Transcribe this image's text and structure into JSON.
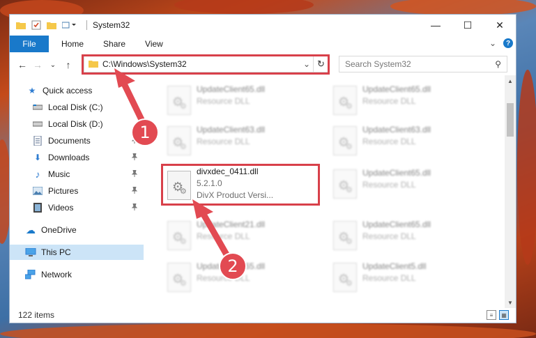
{
  "window": {
    "title": "System32",
    "controls": {
      "minimize": "—",
      "maximize": "☐",
      "close": "✕"
    }
  },
  "ribbon": {
    "tabs": [
      "File",
      "Home",
      "Share",
      "View"
    ],
    "expand_glyph": "⌄",
    "help": "?"
  },
  "nav": {
    "back": "←",
    "forward": "→",
    "recent": "⌄",
    "up": "↑",
    "address": "C:\\Windows\\System32",
    "address_dropdown": "⌄",
    "refresh": "↻",
    "search_placeholder": "Search System32",
    "search_glyph": "⚲"
  },
  "sidebar": {
    "items": [
      {
        "label": "Quick access",
        "icon": "star-icon",
        "glyph": "★",
        "color": "#2f7dd1"
      },
      {
        "label": "Local Disk (C:)",
        "icon": "drive-icon",
        "glyph": "▭",
        "color": "#555555"
      },
      {
        "label": "Local Disk (D:)",
        "icon": "drive-icon",
        "glyph": "▭",
        "color": "#555555"
      },
      {
        "label": "Documents",
        "icon": "documents-icon",
        "glyph": "▤",
        "color": "#5a6e8c",
        "pin": "📌"
      },
      {
        "label": "Downloads",
        "icon": "download-icon",
        "glyph": "⬇",
        "color": "#2f7dd1",
        "pin": "📌"
      },
      {
        "label": "Music",
        "icon": "music-icon",
        "glyph": "♪",
        "color": "#2f7dd1",
        "pin": "📌"
      },
      {
        "label": "Pictures",
        "icon": "pictures-icon",
        "glyph": "▨",
        "color": "#4a7fb0",
        "pin": "📌"
      },
      {
        "label": "Videos",
        "icon": "videos-icon",
        "glyph": "▦",
        "color": "#555555",
        "pin": "📌"
      },
      {
        "label": "OneDrive",
        "icon": "cloud-icon",
        "glyph": "☁",
        "color": "#1979ca"
      },
      {
        "label": "This PC",
        "icon": "computer-icon",
        "glyph": "▭",
        "color": "#2f7dd1"
      },
      {
        "label": "Network",
        "icon": "network-icon",
        "glyph": "⧉",
        "color": "#2f7dd1"
      }
    ]
  },
  "files": [
    {
      "name": "UpdateClient65.dll",
      "sub1": "Resource DLL",
      "sub2": ""
    },
    {
      "name": "UpdateClient65.dll",
      "sub1": "Resource DLL",
      "sub2": ""
    },
    {
      "name": "UpdateClient63.dll",
      "sub1": "Resource DLL",
      "sub2": ""
    },
    {
      "name": "UpdateClient63.dll",
      "sub1": "Resource DLL",
      "sub2": ""
    },
    {
      "name": "divxdec_0411.dll",
      "sub1": "5.2.1.0",
      "sub2": "DivX  Product Versi..."
    },
    {
      "name": "UpdateClient65.dll",
      "sub1": "Resource DLL",
      "sub2": ""
    },
    {
      "name": "UpdateClient21.dll",
      "sub1": "Resource DLL",
      "sub2": ""
    },
    {
      "name": "UpdateClient65.dll",
      "sub1": "Resource DLL",
      "sub2": ""
    },
    {
      "name": "UpdateClient65.dll",
      "sub1": "Resource DLL",
      "sub2": ""
    },
    {
      "name": "UpdateClient5.dll",
      "sub1": "Resource DLL",
      "sub2": ""
    }
  ],
  "status": {
    "item_count": "122 items"
  },
  "annotations": [
    {
      "label": "1",
      "color": "#e24a52"
    },
    {
      "label": "2",
      "color": "#e24a52"
    }
  ]
}
